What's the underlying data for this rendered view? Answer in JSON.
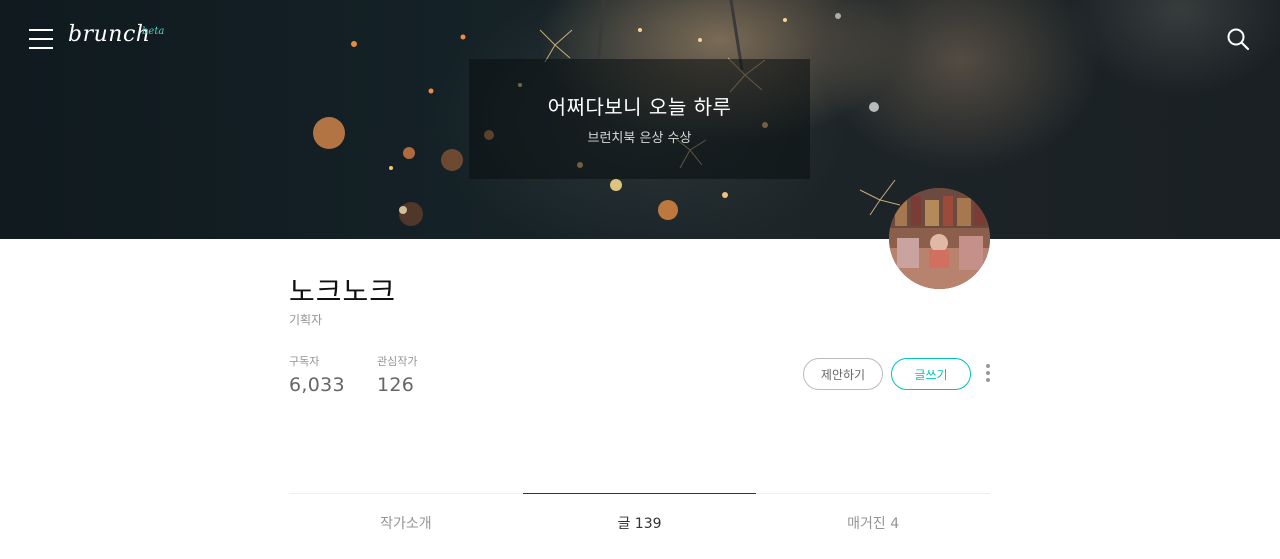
{
  "header": {
    "logo_text": "brunch",
    "logo_badge": "beta",
    "menu_icon": "hamburger-menu-icon",
    "search_icon": "search-icon"
  },
  "cover": {
    "title": "어쩌다보니 오늘 하루",
    "subtitle": "브런치북 은상 수상"
  },
  "profile": {
    "name": "노크노크",
    "role": "기획자",
    "stats": [
      {
        "label": "구독자",
        "value": "6,033"
      },
      {
        "label": "관심작가",
        "value": "126"
      }
    ],
    "buttons": {
      "propose": "제안하기",
      "write": "글쓰기"
    }
  },
  "tabs": [
    {
      "label": "작가소개",
      "active": false
    },
    {
      "label": "글 139",
      "active": true
    },
    {
      "label": "매거진 4",
      "active": false
    }
  ],
  "colors": {
    "accent": "#00c3bd",
    "cover_dark": "#142126"
  }
}
